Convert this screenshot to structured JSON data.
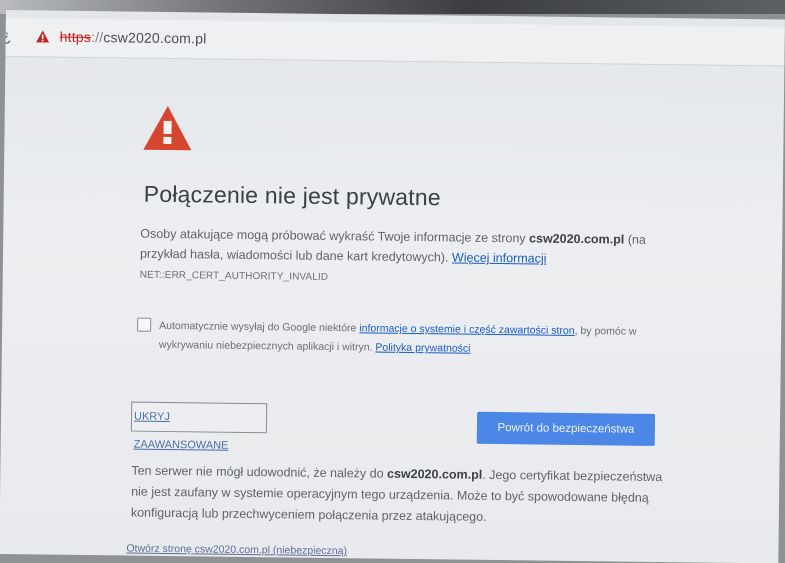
{
  "browser": {
    "nav_fragment": "¿",
    "url_scheme": "https",
    "url_separator": "://",
    "url_host": "csw2020.com.pl"
  },
  "interstitial": {
    "title": "Połączenie nie jest prywatne",
    "intro_before": "Osoby atakujące mogą próbować wykraść Twoje informacje ze strony ",
    "intro_domain": "csw2020.com.pl",
    "intro_after": " (na przykład hasła, wiadomości lub dane kart kredytowych). ",
    "learn_more": "Więcej informacji",
    "error_code": "NET::ERR_CERT_AUTHORITY_INVALID",
    "checkbox_before": "Automatycznie wysyłaj do Google niektóre ",
    "checkbox_link": "informacje o systemie i część zawartości stron",
    "checkbox_middle": ", by pomóc w wykrywaniu niebezpiecznych aplikacji i witryn. ",
    "privacy_link": "Polityka prywatności",
    "advanced_button": "UKRYJ ZAAWANSOWANE",
    "back_button": "Powrót do bezpieczeństwa",
    "details_before": "Ten serwer nie mógł udowodnić, że należy do ",
    "details_domain": "csw2020.com.pl",
    "details_after": ". Jego certyfikat bezpieczeństwa nie jest zaufany w systemie operacyjnym tego urządzenia. Może to być spowodowane błędną konfiguracją lub przechwyceniem połączenia przez atakującego.",
    "proceed_link": "Otwórz stronę csw2020.com.pl (niebezpieczną)"
  },
  "colors": {
    "warning_red": "#d6452f",
    "primary_blue": "#4c86e6",
    "link_blue": "#1a5dc2",
    "title_gray": "#3c4043"
  },
  "icons": {
    "address_warning": "warning-triangle-icon",
    "page_warning": "warning-triangle-icon"
  }
}
